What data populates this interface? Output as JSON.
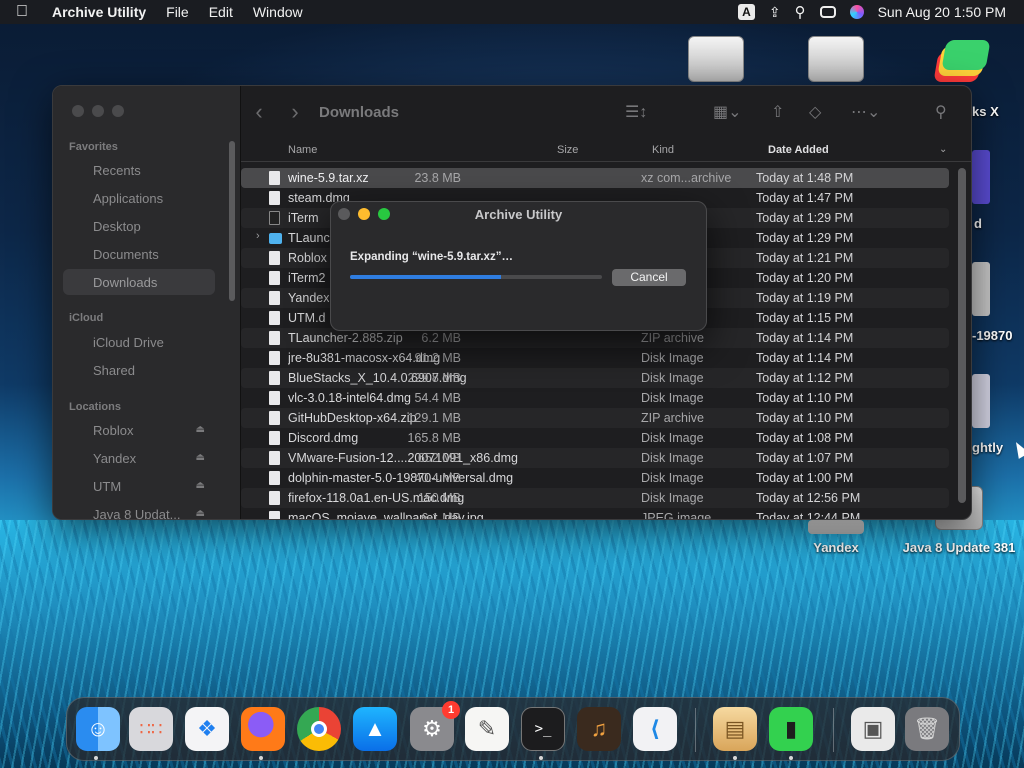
{
  "menubar": {
    "app_name": "Archive Utility",
    "menus": [
      "File",
      "Edit",
      "Window"
    ],
    "input_source": "A",
    "clock": "Sun Aug 20  1:50 PM"
  },
  "desktop": {
    "icons": [
      {
        "label": "ks X"
      },
      {
        "label": "d"
      },
      {
        "label": "-19870"
      },
      {
        "label": "ghtly"
      },
      {
        "label": "Yandex"
      },
      {
        "label": "Java 8 Update 381"
      }
    ]
  },
  "finder": {
    "title": "Downloads",
    "sidebar": {
      "favorites_header": "Favorites",
      "favorites": [
        "Recents",
        "Applications",
        "Desktop",
        "Documents",
        "Downloads"
      ],
      "icloud_header": "iCloud",
      "icloud": [
        "iCloud Drive",
        "Shared"
      ],
      "locations_header": "Locations",
      "locations": [
        "Roblox",
        "Yandex",
        "UTM",
        "Java 8 Updat..."
      ]
    },
    "columns": {
      "name": "Name",
      "size": "Size",
      "kind": "Kind",
      "date": "Date Added"
    },
    "files": [
      {
        "name": "wine-5.9.tar.xz",
        "size": "23.8 MB",
        "kind": "xz com...archive",
        "date": "Today at 1:48 PM"
      },
      {
        "name": "steam.dmg",
        "size": "",
        "kind": "",
        "date": "Today at 1:47 PM"
      },
      {
        "name": "iTerm",
        "size": "",
        "kind": "",
        "date": "Today at 1:29 PM"
      },
      {
        "name": "TLaunc",
        "size": "",
        "kind": "",
        "date": "Today at 1:29 PM"
      },
      {
        "name": "Roblox",
        "size": "",
        "kind": "",
        "date": "Today at 1:21 PM"
      },
      {
        "name": "iTerm2",
        "size": "",
        "kind": "",
        "date": "Today at 1:20 PM"
      },
      {
        "name": "Yandex",
        "size": "",
        "kind": "",
        "date": "Today at 1:19 PM"
      },
      {
        "name": "UTM.d",
        "size": "",
        "kind": "",
        "date": "Today at 1:15 PM"
      },
      {
        "name": "TLauncher-2.885.zip",
        "size": "6.2 MB",
        "kind": "ZIP archive",
        "date": "Today at 1:14 PM"
      },
      {
        "name": "jre-8u381-macosx-x64.dmg",
        "size": "91.2 MB",
        "kind": "Disk Image",
        "date": "Today at 1:14 PM"
      },
      {
        "name": "BlueStacks_X_10.4.0.6907.dmg",
        "size": "229.8 MB",
        "kind": "Disk Image",
        "date": "Today at 1:12 PM"
      },
      {
        "name": "vlc-3.0.18-intel64.dmg",
        "size": "54.4 MB",
        "kind": "Disk Image",
        "date": "Today at 1:10 PM"
      },
      {
        "name": "GitHubDesktop-x64.zip",
        "size": "129.1 MB",
        "kind": "ZIP archive",
        "date": "Today at 1:10 PM"
      },
      {
        "name": "Discord.dmg",
        "size": "165.8 MB",
        "kind": "Disk Image",
        "date": "Today at 1:08 PM"
      },
      {
        "name": "VMware-Fusion-12....20071091_x86.dmg",
        "size": "652 MB",
        "kind": "Disk Image",
        "date": "Today at 1:07 PM"
      },
      {
        "name": "dolphin-master-5.0-19870-universal.dmg",
        "size": "40.4 MB",
        "kind": "Disk Image",
        "date": "Today at 1:00 PM"
      },
      {
        "name": "firefox-118.0a1.en-US.mac.dmg",
        "size": "150 MB",
        "kind": "Disk Image",
        "date": "Today at 12:56 PM"
      },
      {
        "name": "macOS_mojave_wallpaper_day.jpg",
        "size": "6.1 MB",
        "kind": "JPEG image",
        "date": "Today at 12:44 PM"
      }
    ]
  },
  "dialog": {
    "title": "Archive Utility",
    "status": "Expanding “wine-5.9.tar.xz”…",
    "progress": 0.6,
    "cancel_label": "Cancel"
  },
  "dock": {
    "settings_badge": "1",
    "apps": [
      "Finder",
      "Launchpad",
      "Safari",
      "Firefox",
      "Chrome",
      "App Store",
      "System Settings",
      "TextEdit",
      "Terminal",
      "GarageBand",
      "VS Code",
      "Archive Utility",
      "Android File Transfer",
      "Preview",
      "Trash"
    ]
  }
}
